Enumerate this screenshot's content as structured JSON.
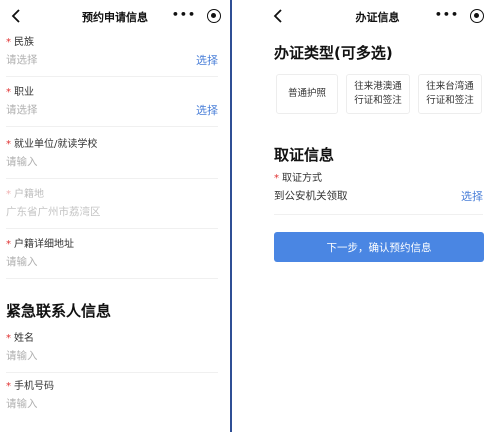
{
  "left": {
    "title": "预约申请信息",
    "more": "•••",
    "fields": [
      {
        "label": "民族",
        "placeholder": "请选择",
        "action": "选择"
      },
      {
        "label": "职业",
        "placeholder": "请选择",
        "action": "选择"
      },
      {
        "label": "就业单位/就读学校",
        "placeholder": "请输入"
      },
      {
        "label": "户籍地",
        "value": "广东省广州市荔湾区"
      },
      {
        "label": "户籍详细地址",
        "placeholder": "请输入"
      }
    ],
    "emergency": {
      "title": "紧急联系人信息",
      "fields": [
        {
          "label": "姓名",
          "placeholder": "请输入"
        },
        {
          "label": "手机号码",
          "placeholder": "请输入"
        }
      ]
    }
  },
  "right": {
    "title": "办证信息",
    "more": "•••",
    "type_title": "办证类型(可多选)",
    "options": [
      {
        "line1": "普通护照",
        "line2": ""
      },
      {
        "line1": "往来港澳通",
        "line2": "行证和签注"
      },
      {
        "line1": "往来台湾通",
        "line2": "行证和签注"
      }
    ],
    "pickup_title": "取证信息",
    "pickup": {
      "label": "取证方式",
      "value": "到公安机关领取",
      "action": "选择"
    },
    "next_label": "下一步，确认预约信息"
  },
  "colors": {
    "accent": "#4a86e3",
    "link": "#4a7fd8",
    "required": "#e03030",
    "divider": "#2f4f95"
  }
}
